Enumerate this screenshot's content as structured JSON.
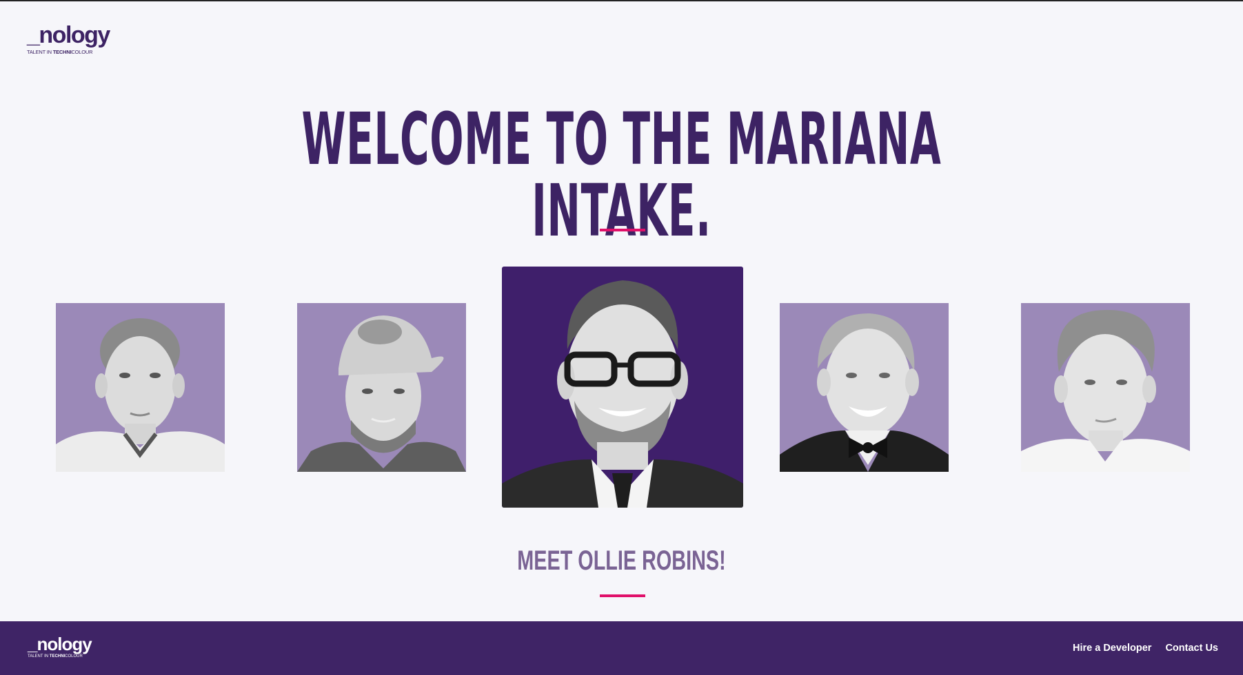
{
  "logo": {
    "wordmark": "_nology",
    "tagline_pre": "TALENT IN ",
    "tagline_bold": "TECHNI",
    "tagline_post": "COLOUR"
  },
  "hero": {
    "title": "WELCOME TO THE MARIANA INTAKE."
  },
  "carousel": {
    "people": [
      {
        "name": "person-1",
        "active": false
      },
      {
        "name": "person-2",
        "active": false
      },
      {
        "name": "ollie-robins",
        "active": true
      },
      {
        "name": "person-4",
        "active": false
      },
      {
        "name": "person-5",
        "active": false
      }
    ],
    "caption": "MEET OLLIE ROBINS!"
  },
  "footer": {
    "logo_wordmark": "_nology",
    "logo_tagline_pre": "TALENT IN ",
    "logo_tagline_bold": "TECHNI",
    "logo_tagline_post": "COLOUR",
    "links": [
      "Hire a Developer",
      "Contact Us"
    ]
  },
  "colors": {
    "brand_purple": "#3d2364",
    "accent_pink": "#e0106a",
    "card_lilac": "#9b89b8",
    "background": "#f6f6fa"
  }
}
